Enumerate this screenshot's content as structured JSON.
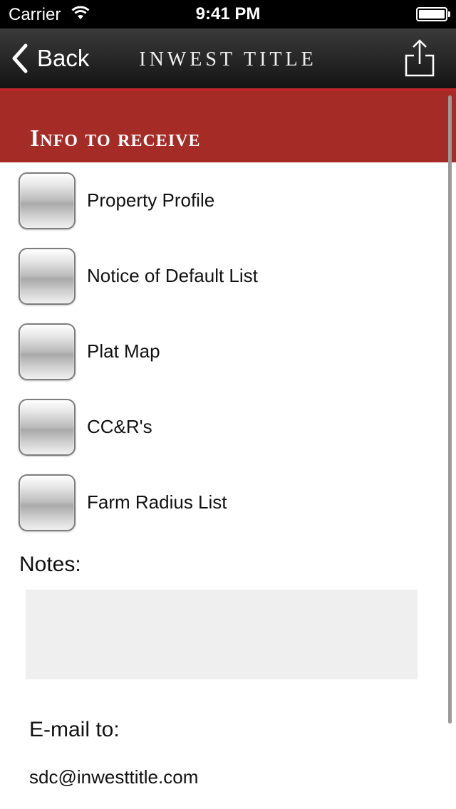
{
  "status_bar": {
    "carrier": "Carrier",
    "time": "9:41 PM"
  },
  "nav": {
    "back_label": "Back",
    "title": "INWEST TITLE",
    "share_icon": "share-icon"
  },
  "section": {
    "heading": "Info to receive",
    "accent_color": "#a52b27"
  },
  "options": [
    {
      "label": "Property Profile",
      "checked": false
    },
    {
      "label": "Notice of Default List",
      "checked": false
    },
    {
      "label": "Plat Map",
      "checked": false
    },
    {
      "label": "CC&R's",
      "checked": false
    },
    {
      "label": "Farm Radius List",
      "checked": false
    }
  ],
  "notes": {
    "label": "Notes:",
    "value": ""
  },
  "email": {
    "label": "E-mail to:",
    "value": "sdc@inwesttitle.com"
  }
}
